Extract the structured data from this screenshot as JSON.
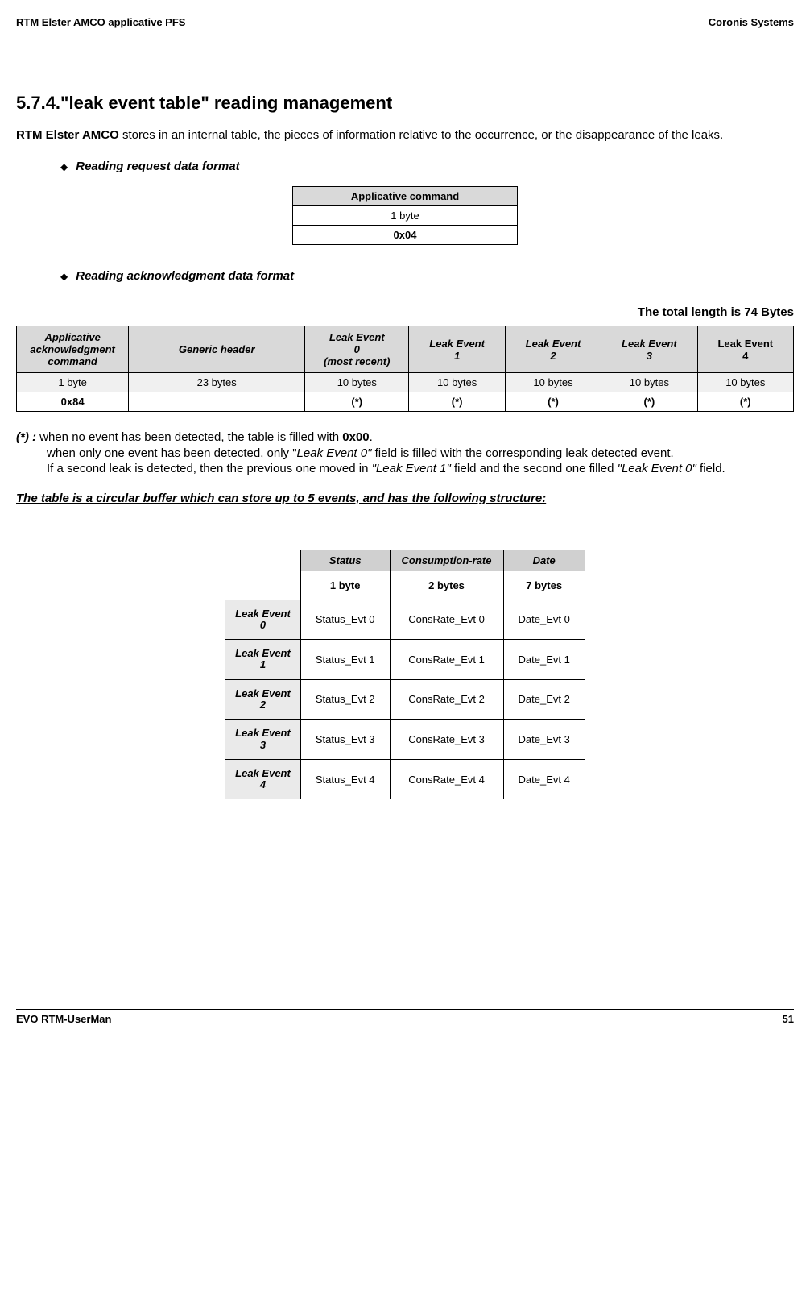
{
  "header": {
    "left": "RTM Elster AMCO applicative PFS",
    "right": "Coronis Systems"
  },
  "section_title": "5.7.4.\"leak event table\" reading management",
  "intro": {
    "part1": "RTM Elster AMCO",
    "part2": " stores in an internal table, the pieces of information relative to the occurrence, or the disappearance of the leaks."
  },
  "bullet1": "Reading request data format",
  "table1": {
    "header": "Applicative command",
    "row1": "1 byte",
    "row2": "0x04"
  },
  "bullet2": "Reading acknowledgment data format",
  "length_note": "The total length is 74 Bytes",
  "table2": {
    "headers": [
      "Applicative acknowledgment command",
      "Generic header",
      "Leak Event 0 (most recent)",
      "Leak Event 1",
      "Leak Event 2",
      "Leak Event 3",
      "Leak Event 4"
    ],
    "row_size": [
      "1 byte",
      "23 bytes",
      "10 bytes",
      "10 bytes",
      "10 bytes",
      "10 bytes",
      "10 bytes"
    ],
    "row_val": [
      "0x84",
      "",
      "(*)",
      "(*)",
      "(*)",
      "(*)",
      "(*)"
    ]
  },
  "note": {
    "lead": "(*) :",
    "p1a": " when no event has been detected, the table is filled with ",
    "p1b": "0x00",
    "p1c": ".",
    "p2a": "when only one event has been detected, only \"",
    "p2b": "Leak Event 0\"",
    "p2c": " field is filled with the corresponding leak detected event.",
    "p3a": "If a second leak is detected, then the previous one moved in ",
    "p3b": "\"Leak Event 1\"",
    "p3c": " field and the second one filled ",
    "p3d": "\"Leak Event 0\"",
    "p3e": " field."
  },
  "underline_text": "The table is a circular buffer which can store up to 5 events, and has the following structure:",
  "table3": {
    "col_headers": [
      "Status",
      "Consumption-rate",
      "Date"
    ],
    "col_sizes": [
      "1 byte",
      "2 bytes",
      "7 bytes"
    ],
    "rows": [
      {
        "label": "Leak Event 0",
        "c1": "Status_Evt 0",
        "c2": "ConsRate_Evt 0",
        "c3": "Date_Evt 0"
      },
      {
        "label": "Leak Event 1",
        "c1": "Status_Evt 1",
        "c2": "ConsRate_Evt 1",
        "c3": "Date_Evt 1"
      },
      {
        "label": "Leak Event 2",
        "c1": "Status_Evt 2",
        "c2": "ConsRate_Evt 2",
        "c3": "Date_Evt 2"
      },
      {
        "label": "Leak Event 3",
        "c1": "Status_Evt 3",
        "c2": "ConsRate_Evt 3",
        "c3": "Date_Evt 3"
      },
      {
        "label": "Leak Event 4",
        "c1": "Status_Evt 4",
        "c2": "ConsRate_Evt 4",
        "c3": "Date_Evt 4"
      }
    ]
  },
  "footer": {
    "left": "EVO RTM-UserMan",
    "right": "51"
  }
}
